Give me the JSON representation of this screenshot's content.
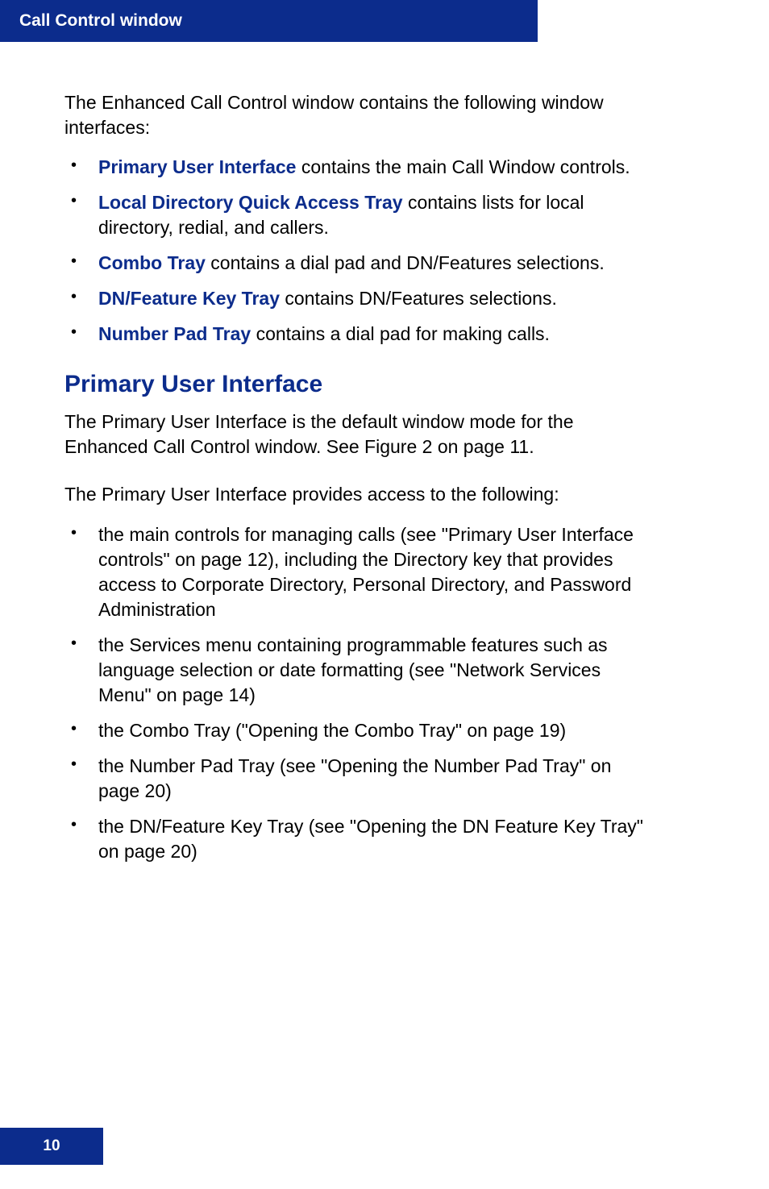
{
  "header": {
    "title": "Call Control window"
  },
  "intro": "The Enhanced Call Control window contains the following window interfaces:",
  "link_items": [
    {
      "term": "Primary User Interface",
      "rest": " contains the main Call Window controls."
    },
    {
      "term": "Local Directory Quick Access Tray",
      "rest": " contains lists for local directory, redial, and callers."
    },
    {
      "term": "Combo Tray",
      "rest": " contains a dial pad and DN/Features selections."
    },
    {
      "term": "DN/Feature Key Tray",
      "rest": " contains DN/Features selections."
    },
    {
      "term": "Number Pad Tray",
      "rest": " contains a dial pad for making calls."
    }
  ],
  "section_heading": "Primary User Interface",
  "para1": "The Primary User Interface is the default window mode for the Enhanced Call Control window. See Figure 2 on page 11.",
  "para2": "The Primary User Interface provides access to the following:",
  "bullets": [
    "the main controls for managing calls (see \"Primary User Interface controls\" on page 12), including the Directory key that provides access to Corporate Directory, Personal Directory, and Password Administration",
    "the Services menu containing programmable features such as language selection or date formatting (see \"Network Services Menu\" on page 14)",
    "the Combo Tray (\"Opening the Combo Tray\" on page 19)",
    "the Number Pad Tray (see \"Opening the Number Pad Tray\" on page 20)",
    "the DN/Feature Key Tray (see \"Opening the DN Feature Key Tray\" on page 20)"
  ],
  "page_number": "10"
}
